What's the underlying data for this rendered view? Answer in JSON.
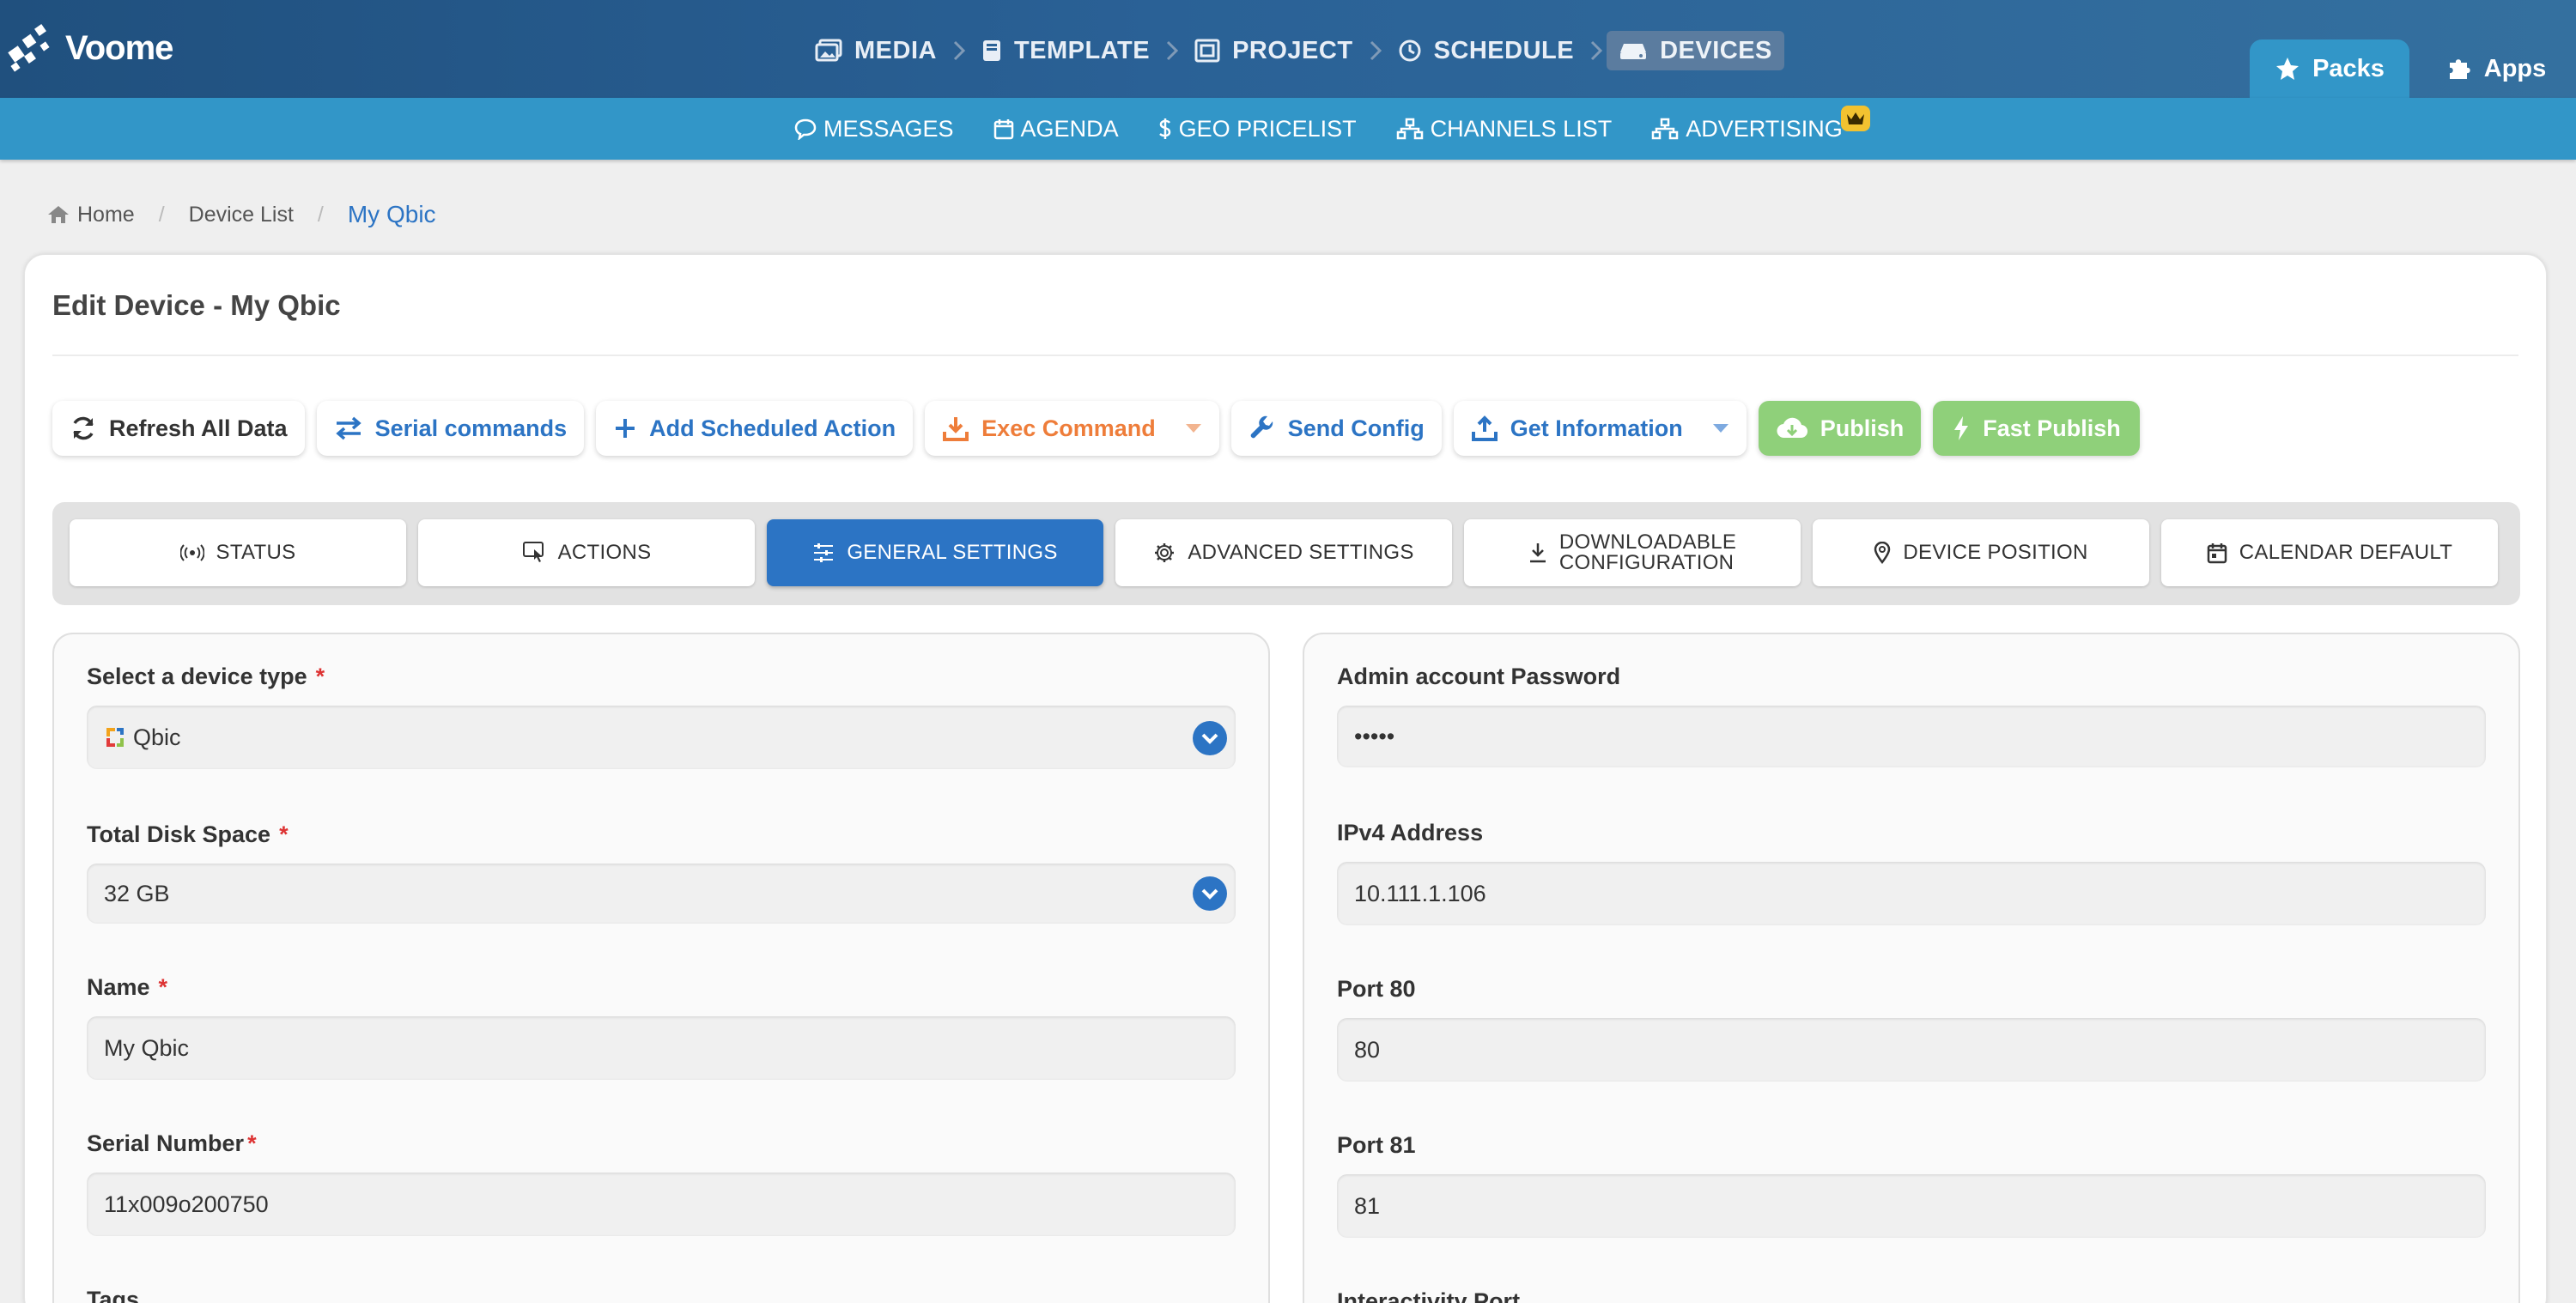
{
  "app": {
    "logo_text": "Voome"
  },
  "pipeline": [
    {
      "label": "MEDIA",
      "icon": "images-icon"
    },
    {
      "label": "TEMPLATE",
      "icon": "book-icon"
    },
    {
      "label": "PROJECT",
      "icon": "project-icon"
    },
    {
      "label": "SCHEDULE",
      "icon": "clock-icon"
    },
    {
      "label": "DEVICES",
      "icon": "devices-icon",
      "active": true
    }
  ],
  "top_tabs": [
    {
      "label": "Packs",
      "icon": "star-icon",
      "active": true
    },
    {
      "label": "Apps",
      "icon": "puzzle-icon"
    }
  ],
  "subnav": [
    {
      "label": "MESSAGES",
      "icon": "chat-icon"
    },
    {
      "label": "AGENDA",
      "icon": "calendar-icon"
    },
    {
      "label": "GEO PRICELIST",
      "icon": "dollar-icon"
    },
    {
      "label": "CHANNELS LIST",
      "icon": "sitemap-icon"
    },
    {
      "label": "ADVERTISING",
      "icon": "sitemap-icon",
      "badge": "crown-icon"
    }
  ],
  "breadcrumb": {
    "home": "Home",
    "device_list": "Device List",
    "current": "My Qbic"
  },
  "card": {
    "title": "Edit Device - My Qbic"
  },
  "actions": {
    "refresh": "Refresh All Data",
    "serial": "Serial commands",
    "add_scheduled": "Add Scheduled Action",
    "exec": "Exec Command",
    "send_config": "Send Config",
    "get_info": "Get Information",
    "publish": "Publish",
    "fast_publish": "Fast Publish"
  },
  "tabs": {
    "status": "STATUS",
    "actions": "ACTIONS",
    "general": "GENERAL SETTINGS",
    "advanced": "ADVANCED SETTINGS",
    "downloadable_1": "DOWNLOADABLE",
    "downloadable_2": "CONFIGURATION",
    "position": "DEVICE POSITION",
    "calendar": "CALENDAR DEFAULT"
  },
  "left_form": {
    "device_type_label": "Select a device type",
    "device_type_value": "Qbic",
    "disk_label": "Total Disk Space",
    "disk_value": "32 GB",
    "name_label": "Name",
    "name_value": "My Qbic",
    "serial_label": "Serial Number",
    "serial_value": "11x009o200750",
    "tags_label": "Tags",
    "required_mark": "*"
  },
  "right_form": {
    "password_label": "Admin account Password",
    "password_value": "•••••",
    "ipv4_label": "IPv4 Address",
    "ipv4_value": "10.111.1.106",
    "port80_label": "Port 80",
    "port80_value": "80",
    "port81_label": "Port 81",
    "port81_value": "81",
    "interactivity_label": "Interactivity Port"
  },
  "colors": {
    "primary": "#2c74c4",
    "topbar": "#2a6196",
    "subnav": "#3296c8",
    "orange": "#ee7d3a",
    "green": "#8fd07a",
    "required": "#dd3333"
  }
}
